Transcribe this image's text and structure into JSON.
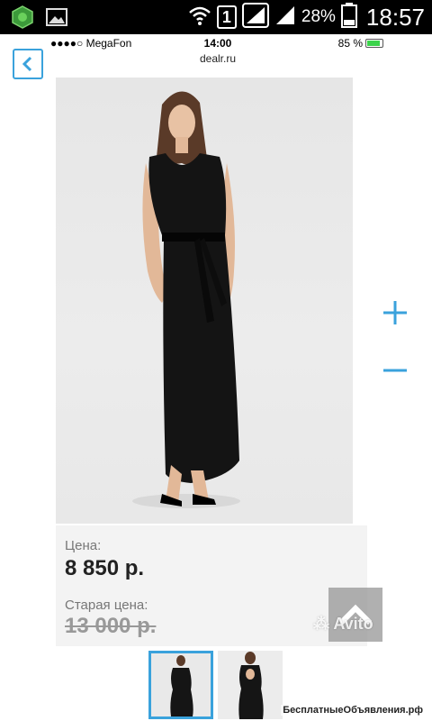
{
  "android_status": {
    "battery_percent": "28%",
    "time": "18:57",
    "sim_badge": "1"
  },
  "ios_status": {
    "carrier": "●●●●○ MegaFon",
    "time": "14:00",
    "battery": "85 %"
  },
  "browser": {
    "url": "dealr.ru"
  },
  "product": {
    "price_label": "Цена:",
    "price": "8 850 р.",
    "old_price_label": "Старая цена:",
    "old_price": "13 000 р."
  },
  "overlay": {
    "brand": "Avito"
  },
  "footer": {
    "watermark": "БесплатныеОбъявления.рф"
  },
  "colors": {
    "accent": "#3aa2dc",
    "status_bar": "#000000"
  }
}
